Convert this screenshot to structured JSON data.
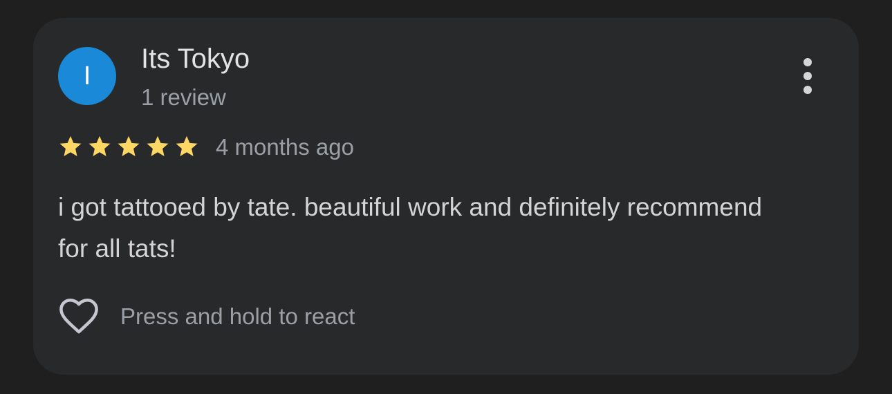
{
  "review": {
    "avatar_initial": "I",
    "avatar_color": "#1a8ad8",
    "author_name": "Its Tokyo",
    "author_review_count": "1 review",
    "rating": 5,
    "rating_max": 5,
    "star_color": "#fdd663",
    "time_ago": "4 months ago",
    "text": "i got tattooed by tate. beautiful work and definitely recommend for all tats!",
    "react_hint": "Press and hold to react",
    "icons": {
      "more": "more-vert-icon",
      "react": "heart-outline-icon",
      "star": "star-icon"
    }
  }
}
